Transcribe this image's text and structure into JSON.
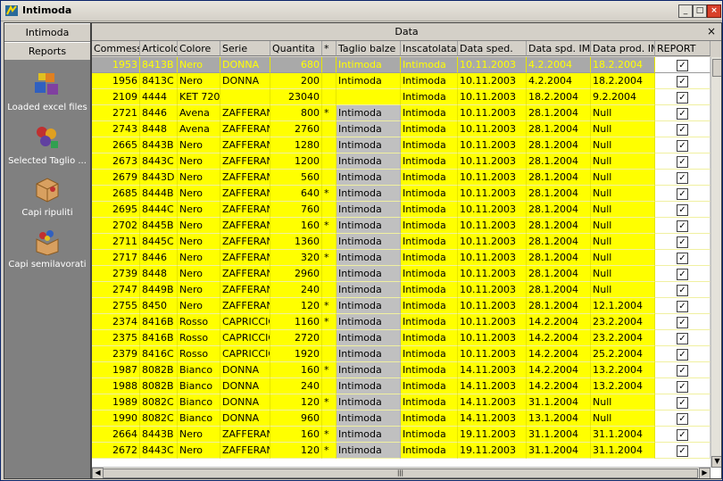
{
  "window": {
    "title": "Intimoda"
  },
  "sidebar": {
    "tabs": [
      {
        "label": "Intimoda"
      },
      {
        "label": "Reports"
      }
    ],
    "items": [
      {
        "label": "Loaded excel files",
        "icon": "blocks-icon"
      },
      {
        "label": "Selected Taglio ...",
        "icon": "stamps-icon"
      },
      {
        "label": "Capi ripuliti",
        "icon": "box-icon"
      },
      {
        "label": "Capi semilavorati",
        "icon": "open-box-icon"
      }
    ]
  },
  "grid": {
    "group_title": "Data",
    "close_label": "×",
    "columns": [
      "Commessa",
      "Articolo",
      "Colore",
      "Serie",
      "Quantita",
      "*",
      "Taglio balze",
      "Inscatolata",
      "Data sped.",
      "Data spd. IM",
      "Data prod. IM",
      "REPORT"
    ],
    "rows": [
      [
        "1953",
        "8413B",
        "Nero",
        "DONNA",
        "680",
        "",
        "Intimoda",
        "Intimoda",
        "10.11.2003",
        "4.2.2004",
        "18.2.2004",
        true
      ],
      [
        "1956",
        "8413C",
        "Nero",
        "DONNA",
        "200",
        "",
        "Intimoda",
        "Intimoda",
        "10.11.2003",
        "4.2.2004",
        "18.2.2004",
        true
      ],
      [
        "2109",
        "4444",
        "KET 720",
        "",
        "23040",
        "",
        "",
        "Intimoda",
        "10.11.2003",
        "18.2.2004",
        "9.2.2004",
        true
      ],
      [
        "2721",
        "8446",
        "Avena",
        "ZAFFERAN",
        "800",
        "*",
        "Intimoda",
        "Intimoda",
        "10.11.2003",
        "28.1.2004",
        "Null",
        true
      ],
      [
        "2743",
        "8448",
        "Avena",
        "ZAFFERAN",
        "2760",
        "",
        "Intimoda",
        "Intimoda",
        "10.11.2003",
        "28.1.2004",
        "Null",
        true
      ],
      [
        "2665",
        "8443B",
        "Nero",
        "ZAFFERAN",
        "1280",
        "",
        "Intimoda",
        "Intimoda",
        "10.11.2003",
        "28.1.2004",
        "Null",
        true
      ],
      [
        "2673",
        "8443C",
        "Nero",
        "ZAFFERAN",
        "1200",
        "",
        "Intimoda",
        "Intimoda",
        "10.11.2003",
        "28.1.2004",
        "Null",
        true
      ],
      [
        "2679",
        "8443D",
        "Nero",
        "ZAFFERAN",
        "560",
        "",
        "Intimoda",
        "Intimoda",
        "10.11.2003",
        "28.1.2004",
        "Null",
        true
      ],
      [
        "2685",
        "8444B",
        "Nero",
        "ZAFFERAN",
        "640",
        "*",
        "Intimoda",
        "Intimoda",
        "10.11.2003",
        "28.1.2004",
        "Null",
        true
      ],
      [
        "2695",
        "8444C",
        "Nero",
        "ZAFFERAN",
        "760",
        "",
        "Intimoda",
        "Intimoda",
        "10.11.2003",
        "28.1.2004",
        "Null",
        true
      ],
      [
        "2702",
        "8445B",
        "Nero",
        "ZAFFERAN",
        "160",
        "*",
        "Intimoda",
        "Intimoda",
        "10.11.2003",
        "28.1.2004",
        "Null",
        true
      ],
      [
        "2711",
        "8445C",
        "Nero",
        "ZAFFERAN",
        "1360",
        "",
        "Intimoda",
        "Intimoda",
        "10.11.2003",
        "28.1.2004",
        "Null",
        true
      ],
      [
        "2717",
        "8446",
        "Nero",
        "ZAFFERAN",
        "320",
        "*",
        "Intimoda",
        "Intimoda",
        "10.11.2003",
        "28.1.2004",
        "Null",
        true
      ],
      [
        "2739",
        "8448",
        "Nero",
        "ZAFFERAN",
        "2960",
        "",
        "Intimoda",
        "Intimoda",
        "10.11.2003",
        "28.1.2004",
        "Null",
        true
      ],
      [
        "2747",
        "8449B",
        "Nero",
        "ZAFFERAN",
        "240",
        "",
        "Intimoda",
        "Intimoda",
        "10.11.2003",
        "28.1.2004",
        "Null",
        true
      ],
      [
        "2755",
        "8450",
        "Nero",
        "ZAFFERAN",
        "120",
        "*",
        "Intimoda",
        "Intimoda",
        "10.11.2003",
        "28.1.2004",
        "12.1.2004",
        true
      ],
      [
        "2374",
        "8416B",
        "Rosso",
        "CAPRICCIO",
        "1160",
        "*",
        "Intimoda",
        "Intimoda",
        "10.11.2003",
        "14.2.2004",
        "23.2.2004",
        true
      ],
      [
        "2375",
        "8416B",
        "Rosso",
        "CAPRICCIO",
        "2720",
        "",
        "Intimoda",
        "Intimoda",
        "10.11.2003",
        "14.2.2004",
        "23.2.2004",
        true
      ],
      [
        "2379",
        "8416C",
        "Rosso",
        "CAPRICCIO",
        "1920",
        "",
        "Intimoda",
        "Intimoda",
        "10.11.2003",
        "14.2.2004",
        "25.2.2004",
        true
      ],
      [
        "1987",
        "8082B",
        "Bianco",
        "DONNA",
        "160",
        "*",
        "Intimoda",
        "Intimoda",
        "14.11.2003",
        "14.2.2004",
        "13.2.2004",
        true
      ],
      [
        "1988",
        "8082B",
        "Bianco",
        "DONNA",
        "240",
        "",
        "Intimoda",
        "Intimoda",
        "14.11.2003",
        "14.2.2004",
        "13.2.2004",
        true
      ],
      [
        "1989",
        "8082C",
        "Bianco",
        "DONNA",
        "120",
        "*",
        "Intimoda",
        "Intimoda",
        "14.11.2003",
        "31.1.2004",
        "Null",
        true
      ],
      [
        "1990",
        "8082C",
        "Bianco",
        "DONNA",
        "960",
        "",
        "Intimoda",
        "Intimoda",
        "14.11.2003",
        "13.1.2004",
        "Null",
        true
      ],
      [
        "2664",
        "8443B",
        "Nero",
        "ZAFFERAN",
        "160",
        "*",
        "Intimoda",
        "Intimoda",
        "19.11.2003",
        "31.1.2004",
        "31.1.2004",
        true
      ],
      [
        "2672",
        "8443C",
        "Nero",
        "ZAFFERAN",
        "120",
        "*",
        "Intimoda",
        "Intimoda",
        "19.11.2003",
        "31.1.2004",
        "31.1.2004",
        true
      ]
    ],
    "selected_row": 0,
    "gray_taglio_from_row": 3
  },
  "colors": {
    "row_fill": "#ffff00",
    "selected_fill": "#a9a9a9",
    "sidebar_bg": "#808080"
  }
}
